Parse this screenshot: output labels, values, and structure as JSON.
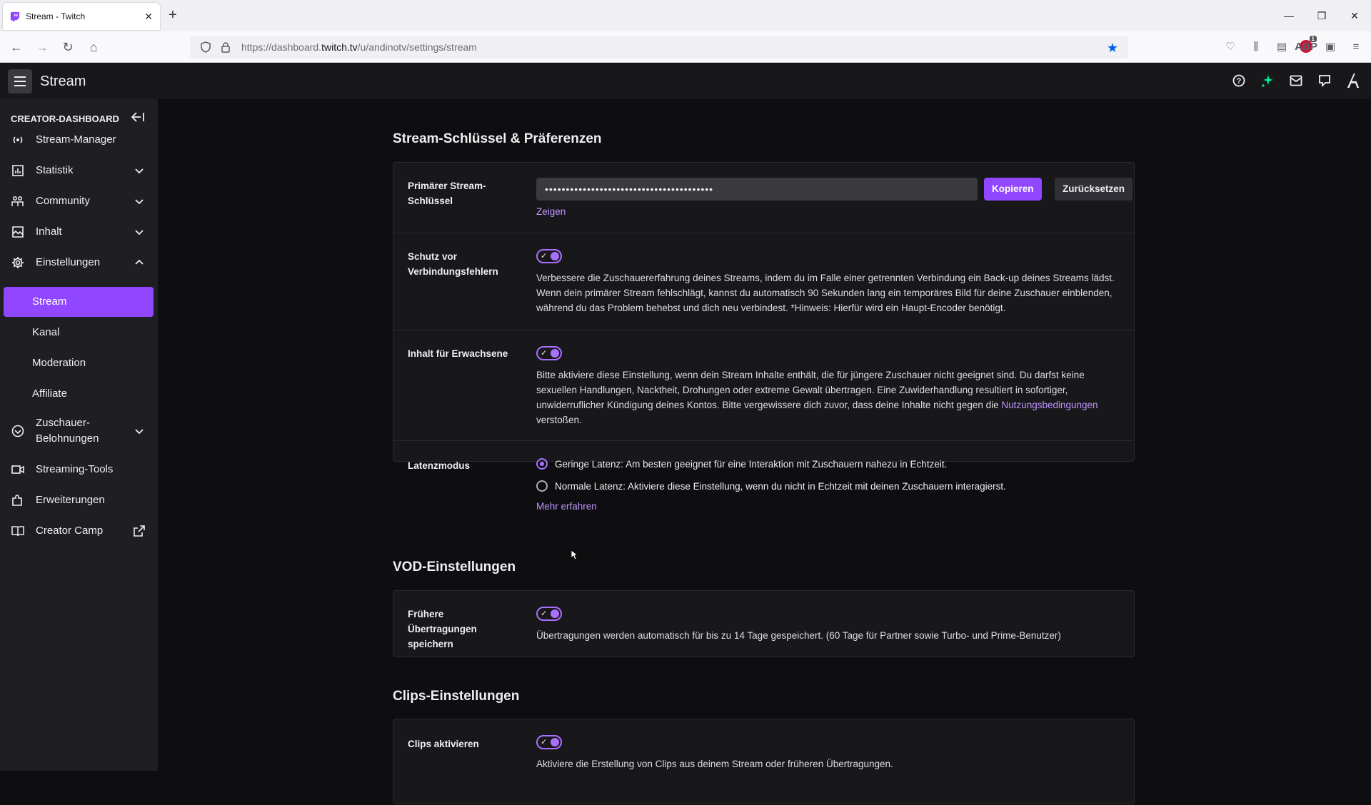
{
  "browser": {
    "tab_title": "Stream - Twitch",
    "url_prefix": "https://dashboard.",
    "url_domain": "twitch.tv",
    "url_path": "/u/andinotv/settings/stream",
    "abp_label": "ABP",
    "abp_badge": "1"
  },
  "topbar": {
    "title": "Stream"
  },
  "sidebar": {
    "header": "CREATOR-DASHBOARD",
    "items": [
      {
        "label": "Stream-Manager",
        "icon": "broadcast-icon"
      },
      {
        "label": "Statistik",
        "icon": "stats-icon"
      },
      {
        "label": "Community",
        "icon": "community-icon"
      },
      {
        "label": "Inhalt",
        "icon": "content-icon"
      },
      {
        "label": "Einstellungen",
        "icon": "settings-gear-icon"
      },
      {
        "label": "Stream"
      },
      {
        "label": "Kanal"
      },
      {
        "label": "Moderation"
      },
      {
        "label": "Affiliate"
      },
      {
        "label": "Zuschauer-Belohnungen",
        "icon": "rewards-icon"
      },
      {
        "label": "Streaming-Tools",
        "icon": "camera-icon"
      },
      {
        "label": "Erweiterungen",
        "icon": "extensions-icon"
      },
      {
        "label": "Creator Camp",
        "icon": "book-icon"
      }
    ]
  },
  "main": {
    "section1_title": "Stream-Schlüssel & Präferenzen",
    "stream_key": {
      "label": "Primärer Stream-Schlüssel",
      "value": "••••••••••••••••••••••••••••••••••••••••",
      "copy_button": "Kopieren",
      "reset_button": "Zurücksetzen",
      "show_link": "Zeigen"
    },
    "disconnect": {
      "label": "Schutz vor Verbindungsfehlern",
      "description": "Verbessere die Zuschauererfahrung deines Streams, indem du im Falle einer getrennten Verbindung ein Back-up deines Streams lädst. Wenn dein primärer Stream fehlschlägt, kannst du automatisch 90 Sekunden lang ein temporäres Bild für deine Zuschauer einblenden, während du das Problem behebst und dich neu verbindest. *Hinweis: Hierfür wird ein Haupt-Encoder benötigt."
    },
    "mature": {
      "label": "Inhalt für Erwachsene",
      "description": "Bitte aktiviere diese Einstellung, wenn dein Stream Inhalte enthält, die für jüngere Zuschauer nicht geeignet sind. Du darfst keine sexuellen Handlungen, Nacktheit, Drohungen oder extreme Gewalt übertragen. Eine Zuwiderhandlung resultiert in sofortiger, unwiderruflicher Kündigung deines Kontos. Bitte vergewissere dich zuvor, dass deine Inhalte nicht gegen die",
      "tos_link": "Nutzungsbedingungen",
      "description_end": "verstoßen."
    },
    "latency": {
      "label": "Latenzmodus",
      "low": "Geringe Latenz: Am besten geeignet für eine Interaktion mit Zuschauern nahezu in Echtzeit.",
      "normal": "Normale Latenz: Aktiviere diese Einstellung, wenn du nicht in Echtzeit mit deinen Zuschauern interagierst.",
      "learn_more": "Mehr erfahren"
    },
    "section2_title": "VOD-Einstellungen",
    "vod": {
      "label": "Frühere Übertragungen speichern",
      "description": "Übertragungen werden automatisch für bis zu 14 Tage gespeichert. (60 Tage für Partner sowie Turbo- und Prime-Benutzer)"
    },
    "section3_title": "Clips-Einstellungen",
    "clips": {
      "label": "Clips aktivieren",
      "description": "Aktiviere die Erstellung von Clips aus deinem Stream oder früheren Übertragungen."
    }
  },
  "colors": {
    "accent": "#9147ff",
    "link": "#bf94ff",
    "background": "#0e0e10",
    "sidebar": "#1f1f23",
    "card": "#18181b"
  }
}
